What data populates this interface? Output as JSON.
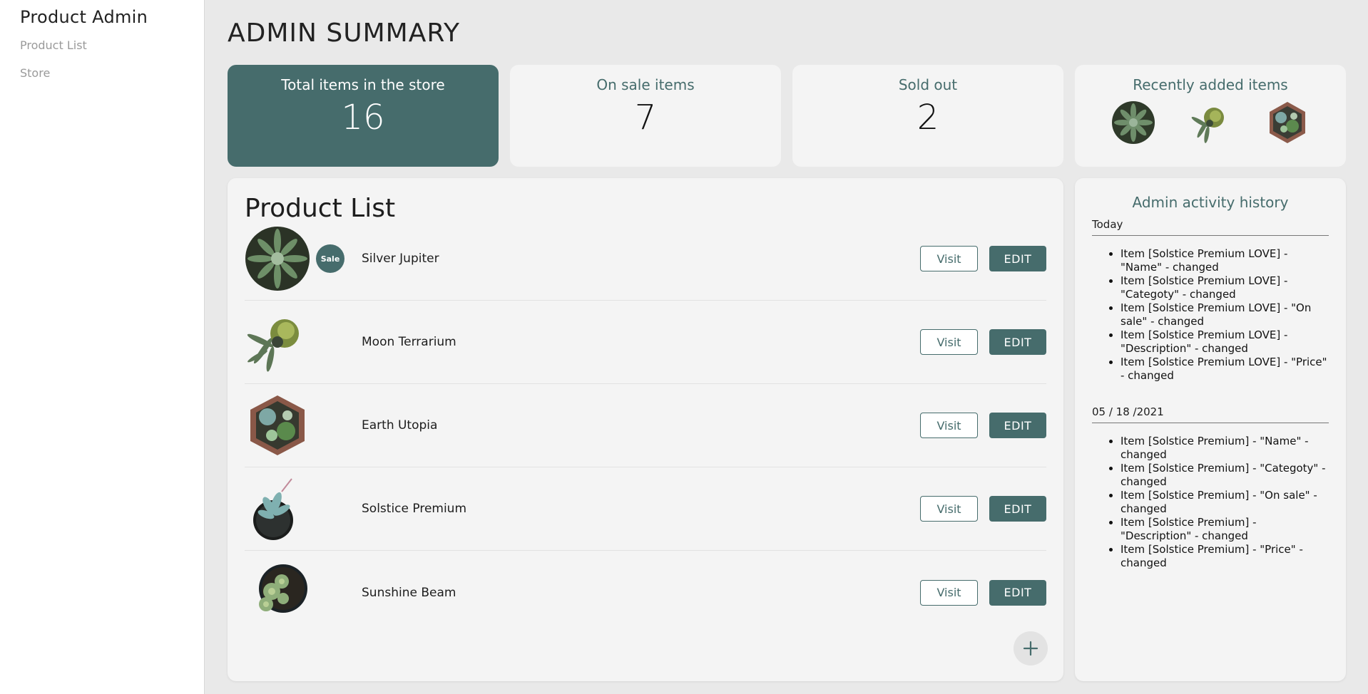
{
  "sidebar": {
    "brand": "Product Admin",
    "nav": [
      {
        "label": "Product List"
      },
      {
        "label": "Store"
      }
    ]
  },
  "header": {
    "title": "ADMIN SUMMARY"
  },
  "stats": {
    "total": {
      "label": "Total items in the store",
      "value": "16"
    },
    "on_sale": {
      "label": "On sale items",
      "value": "7"
    },
    "sold_out": {
      "label": "Sold out",
      "value": "2"
    },
    "recent": {
      "label": "Recently added items"
    }
  },
  "product_list": {
    "title": "Product List",
    "visit_label": "Visit",
    "edit_label": "EDIT",
    "sale_label": "Sale",
    "items": [
      {
        "name": "Silver Jupiter",
        "on_sale": true
      },
      {
        "name": "Moon Terrarium",
        "on_sale": false
      },
      {
        "name": "Earth Utopia",
        "on_sale": false
      },
      {
        "name": "Solstice Premium",
        "on_sale": false
      },
      {
        "name": "Sunshine Beam",
        "on_sale": false
      }
    ]
  },
  "activity": {
    "title": "Admin activity history",
    "groups": [
      {
        "date": "Today",
        "entries": [
          "Item [Solstice Premium LOVE] - \"Name\" - changed",
          "Item [Solstice Premium LOVE] - \"Categoty\" - changed",
          "Item [Solstice Premium LOVE] - \"On sale\" - changed",
          "Item [Solstice Premium LOVE] - \"Description\" - changed",
          "Item [Solstice Premium LOVE] - \"Price\" - changed"
        ]
      },
      {
        "date": "05 / 18 /2021",
        "entries": [
          "Item [Solstice Premium] - \"Name\" - changed",
          "Item [Solstice Premium] - \"Categoty\" - changed",
          "Item [Solstice Premium] - \"On sale\" - changed",
          "Item [Solstice Premium] - \"Description\" - changed",
          "Item [Solstice Premium] - \"Price\" - changed"
        ]
      }
    ]
  },
  "colors": {
    "accent": "#466c6c",
    "panel": "#f4f4f4",
    "background": "#e9e9e9"
  },
  "icons": {
    "add": "plus-icon"
  }
}
